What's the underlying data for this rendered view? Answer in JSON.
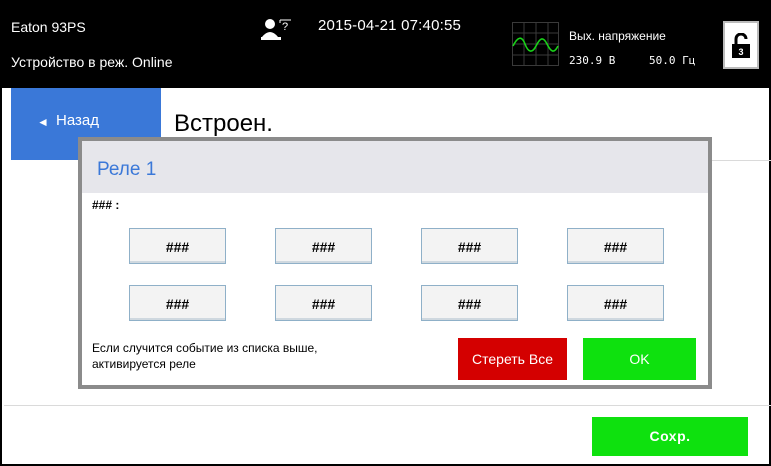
{
  "header": {
    "device_name": "Eaton 93PS",
    "device_status": "Устройство в реж. Online",
    "datetime": "2015-04-21 07:40:55",
    "user_icon": "user-question-icon",
    "output": {
      "label": "Вых. напряжение",
      "voltage": "230.9 В",
      "frequency": "50.0 Гц",
      "icon": "sine-wave-icon"
    },
    "lock_icon": "padlock-icon"
  },
  "nav": {
    "back_arrow": "◄",
    "back_label": "Назад",
    "page_title": "Встроен."
  },
  "dialog": {
    "title": "Реле 1",
    "subtitle": "### :",
    "cells": [
      "###",
      "###",
      "###",
      "###",
      "###",
      "###",
      "###",
      "###"
    ],
    "note_line1": "Если случится событие из списка выше,",
    "note_line2": "активируется реле",
    "clear_label": "Стереть Все",
    "ok_label": "OK"
  },
  "footer": {
    "save_label": "Сохр."
  },
  "colors": {
    "accent_blue": "#3a78d8",
    "green": "#0ee10e",
    "red": "#d40000",
    "header_bg": "#000000"
  }
}
